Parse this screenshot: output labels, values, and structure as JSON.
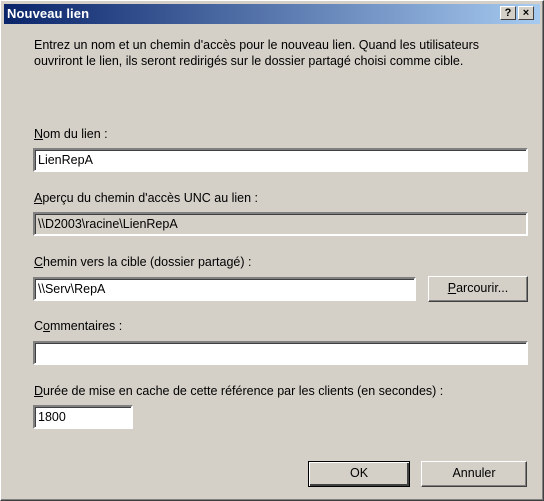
{
  "window": {
    "title": "Nouveau lien",
    "help_button": "?",
    "close_button": "×"
  },
  "intro_text": "Entrez un nom et un chemin d'accès pour le nouveau lien. Quand les utilisateurs ouvriront le lien, ils seront redirigés sur le dossier partagé choisi comme cible.",
  "link_name": {
    "label_accel": "N",
    "label_rest": "om du lien :",
    "value": "LienRepA"
  },
  "unc_preview": {
    "label_accel": "A",
    "label_rest": "perçu du chemin d'accès UNC au lien :",
    "value": "\\\\D2003\\racine\\LienRepA"
  },
  "target_path": {
    "label_accel": "C",
    "label_rest": "hemin vers la cible (dossier partagé) :",
    "value": "\\\\Serv\\RepA",
    "browse_accel": "P",
    "browse_rest": "arcourir..."
  },
  "comments": {
    "label_pre": "C",
    "label_accel": "o",
    "label_rest": "mmentaires :",
    "value": ""
  },
  "cache_duration": {
    "label_accel": "D",
    "label_rest": "urée de mise en cache de cette référence par les clients (en secondes) :",
    "value": "1800"
  },
  "buttons": {
    "ok": "OK",
    "cancel": "Annuler"
  }
}
